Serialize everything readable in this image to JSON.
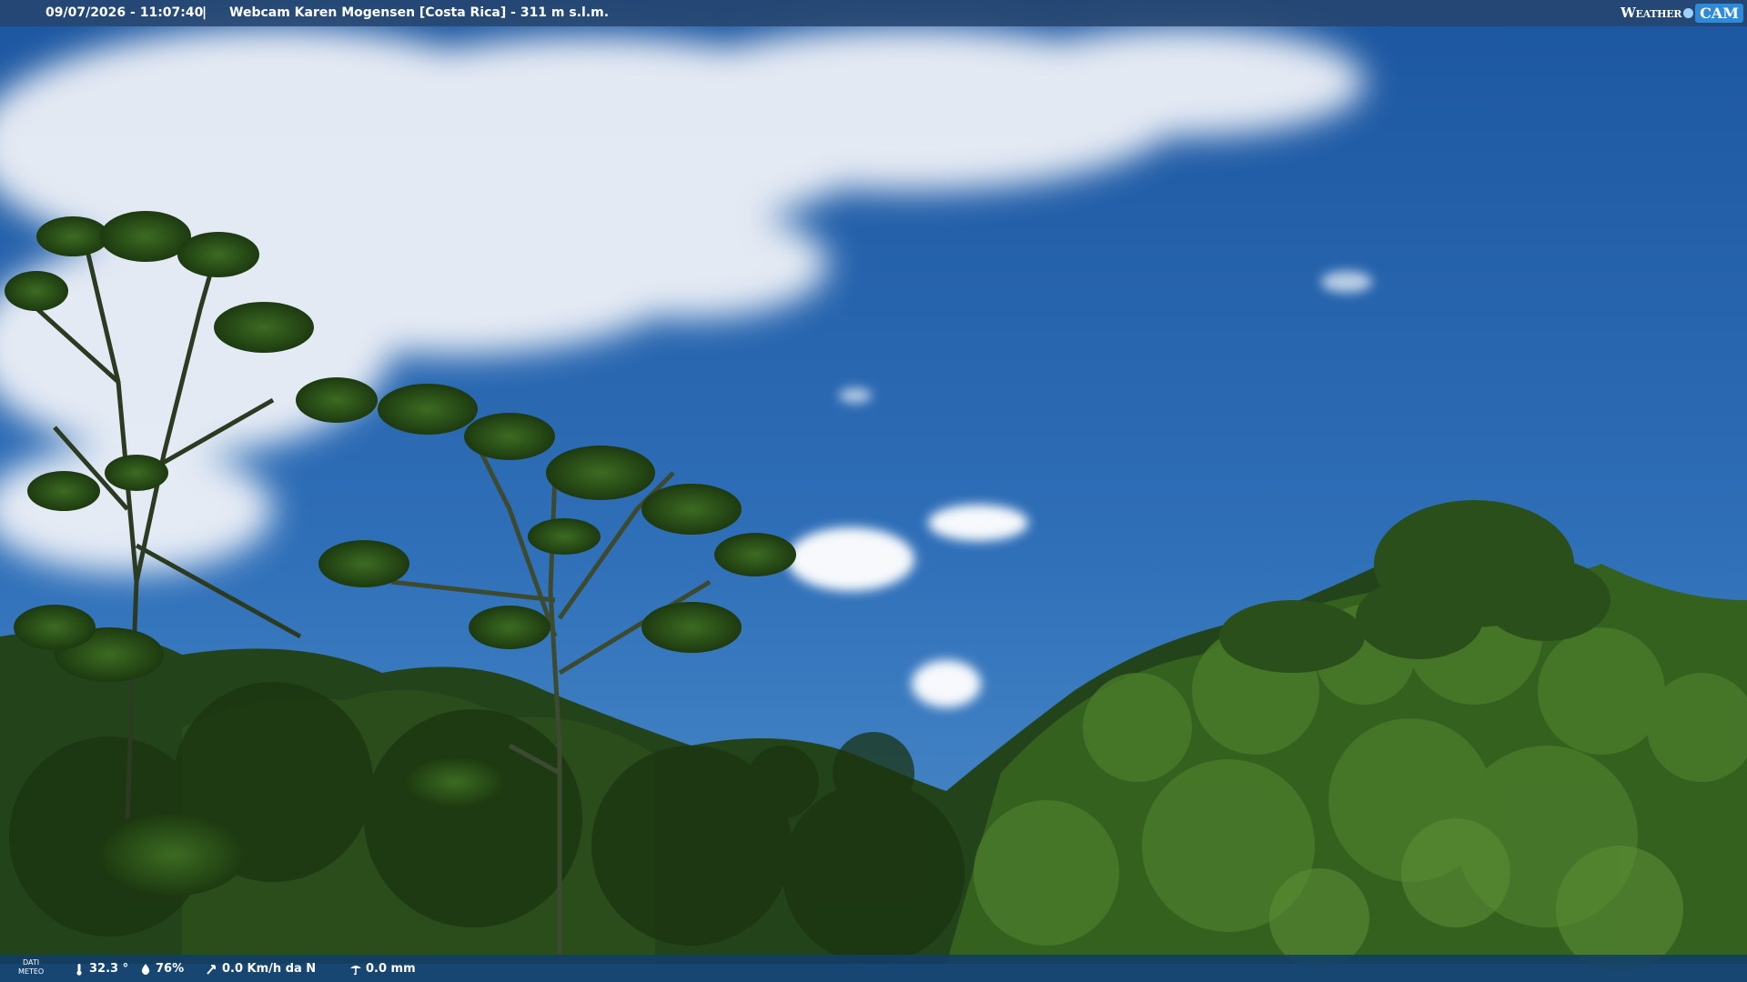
{
  "header": {
    "timestamp": "09/07/2026 - 11:07:40",
    "separator": "|",
    "title": "Webcam Karen Mogensen [Costa Rica]  - 311 m s.l.m.",
    "logo_weather": "Weather",
    "logo_cam": "CAM"
  },
  "footer": {
    "label_line1": "DATI",
    "label_line2": "METEO",
    "temperature": "32.3 °",
    "humidity": "76%",
    "wind": "0.0 Km/h da N",
    "rain": "0.0 mm",
    "icons": [
      "thermometer-icon",
      "humidity-icon",
      "wind-icon",
      "rain-icon"
    ]
  },
  "colors": {
    "sky_top": "#1e5aa3",
    "sky_bottom": "#3b7fc4",
    "cloud": "#f2f5fa",
    "foliage_dark": "#1f3a12",
    "foliage_mid": "#2f5a1c",
    "foliage_light": "#4c7d2c"
  }
}
